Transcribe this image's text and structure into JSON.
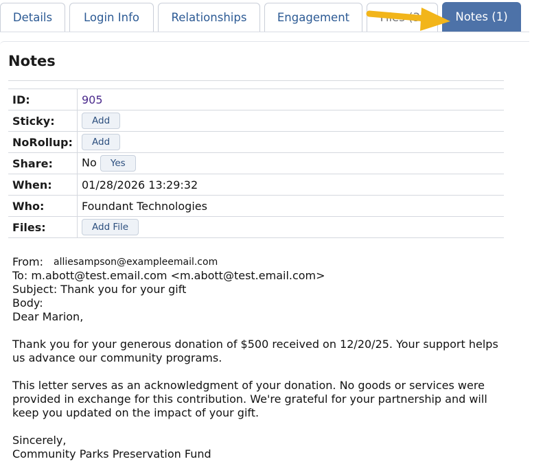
{
  "tabs": [
    {
      "label": "Details"
    },
    {
      "label": "Login Info"
    },
    {
      "label": "Relationships"
    },
    {
      "label": "Engagement"
    },
    {
      "label": "Files (3)"
    },
    {
      "label": "Notes (1)"
    }
  ],
  "colors": {
    "active_tab": "#4d72a8",
    "tab_text": "#2c5a94",
    "arrow": "#f2b51a"
  },
  "icons": {
    "arrow": "arrow-annotation"
  },
  "panel": {
    "title": "Notes"
  },
  "fields": {
    "id": {
      "label": "ID:",
      "value": "905"
    },
    "sticky": {
      "label": "Sticky:",
      "button": "Add"
    },
    "norollup": {
      "label": "NoRollup:",
      "button": "Add"
    },
    "share": {
      "label": "Share:",
      "value": "No",
      "button": "Yes"
    },
    "when": {
      "label": "When:",
      "value": "01/28/2026 13:29:32"
    },
    "who": {
      "label": "Who:",
      "value": "Foundant Technologies"
    },
    "files": {
      "label": "Files:",
      "button": "Add File"
    }
  },
  "email": {
    "from_label": "From:",
    "from_address": "alliesampson@exampleemail.com",
    "to": "To: m.abott@test.email.com <m.abott@test.email.com>",
    "subject": "Subject: Thank you for your gift",
    "body_label": "Body:",
    "greeting": "Dear Marion,",
    "para1_line1": "Thank you for your generous donation of $500 received on 12/20/25. Your support helps",
    "para1_line2": "us advance our community programs.",
    "para2_line1": "This letter serves as an acknowledgment of your donation. No goods or services were",
    "para2_line2": "provided in exchange for this contribution. We're grateful for your partnership and will",
    "para2_line3": "keep you updated on the impact of your gift.",
    "closing": "Sincerely,",
    "signature": "Community Parks Preservation Fund"
  }
}
